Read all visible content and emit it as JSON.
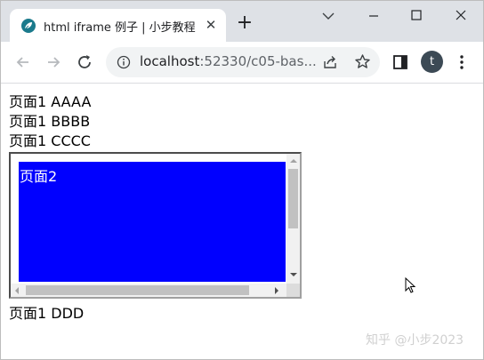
{
  "tab": {
    "title": "html iframe 例子 | 小步教程",
    "close_glyph": "✕",
    "favicon": "leaf-icon"
  },
  "new_tab_glyph": "+",
  "window_controls": {
    "chevron": "chevron-down-icon",
    "minimize": "minimize-icon",
    "maximize": "maximize-icon",
    "close": "close-icon"
  },
  "toolbar": {
    "url_host": "localhost",
    "url_rest": ":52330/c05-bas...",
    "avatar_letter": "t",
    "avatar_color": "#3c4a55"
  },
  "page": {
    "lines": [
      "页面1 AAAA",
      "页面1 BBBB",
      "页面1 CCCC",
      "页面1 DDD"
    ],
    "iframe": {
      "text": "页面2",
      "background": "#0000ff"
    }
  },
  "watermark": "知乎 @小步2023"
}
